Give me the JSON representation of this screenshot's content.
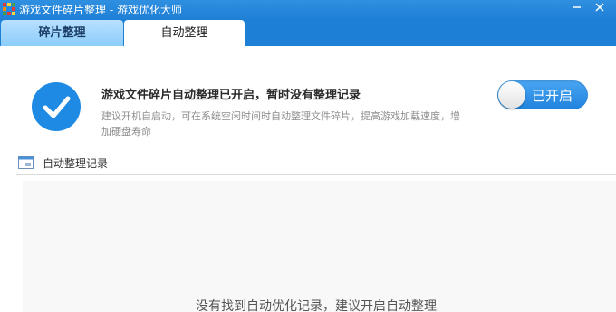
{
  "window": {
    "title": "游戏文件碎片整理 - 游戏优化大师",
    "title_bar_color": "#1e7fd6"
  },
  "tabs": [
    {
      "label": "碎片整理",
      "selected": false
    },
    {
      "label": "自动整理",
      "selected": true
    }
  ],
  "status": {
    "icon": "checkmark-circle-icon",
    "title": "游戏文件碎片自动整理已开启，暂时没有整理记录",
    "description": "建议开机自启动，可在系统空闲时间时自动整理文件碎片，提高游戏加载速度，增加硬盘寿命",
    "accent_color": "#1f8ae3"
  },
  "toggle": {
    "label": "已开启",
    "on": true
  },
  "records": {
    "icon": "calendar-icon",
    "title": "自动整理记录",
    "empty_message": "没有找到自动优化记录，建议开启自动整理"
  }
}
